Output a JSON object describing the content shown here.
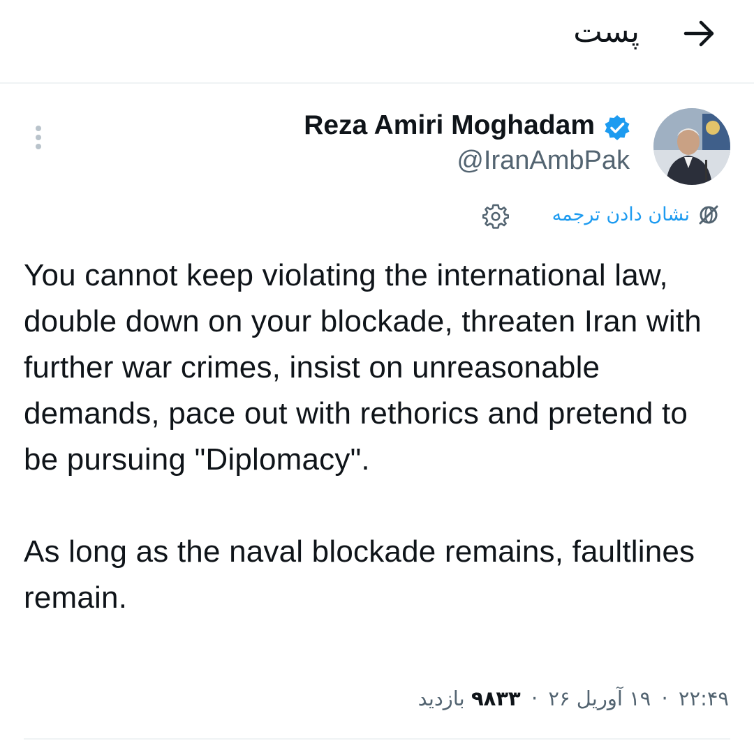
{
  "header": {
    "title": "پست"
  },
  "author": {
    "display_name": "Reza Amiri Moghadam",
    "handle": "@IranAmbPak",
    "verified": true
  },
  "translate": {
    "label": "نشان دادن ترجمه"
  },
  "tweet": {
    "paragraphs": [
      "You cannot keep violating the international law, double down on your blockade, threaten Iran with further war crimes, insist on unreasonable demands, pace out with rethorics and pretend to be pursuing \"Diplomacy\".",
      "As long as the naval blockade remains, faultlines remain."
    ]
  },
  "meta": {
    "time": "۲۲:۴۹",
    "date": "۱۹ آوریل ۲۶",
    "views_count": "۹۸۳۳",
    "views_label": "بازدید",
    "separator": "·"
  },
  "colors": {
    "accent": "#1d9bf0",
    "text_primary": "#0f1419",
    "text_secondary": "#536471",
    "divider": "#eff3f4"
  },
  "icons": {
    "back": "arrow-right-icon",
    "more": "more-vertical-icon",
    "verified": "verified-badge-icon",
    "translate": "translate-icon",
    "settings": "gear-icon"
  }
}
